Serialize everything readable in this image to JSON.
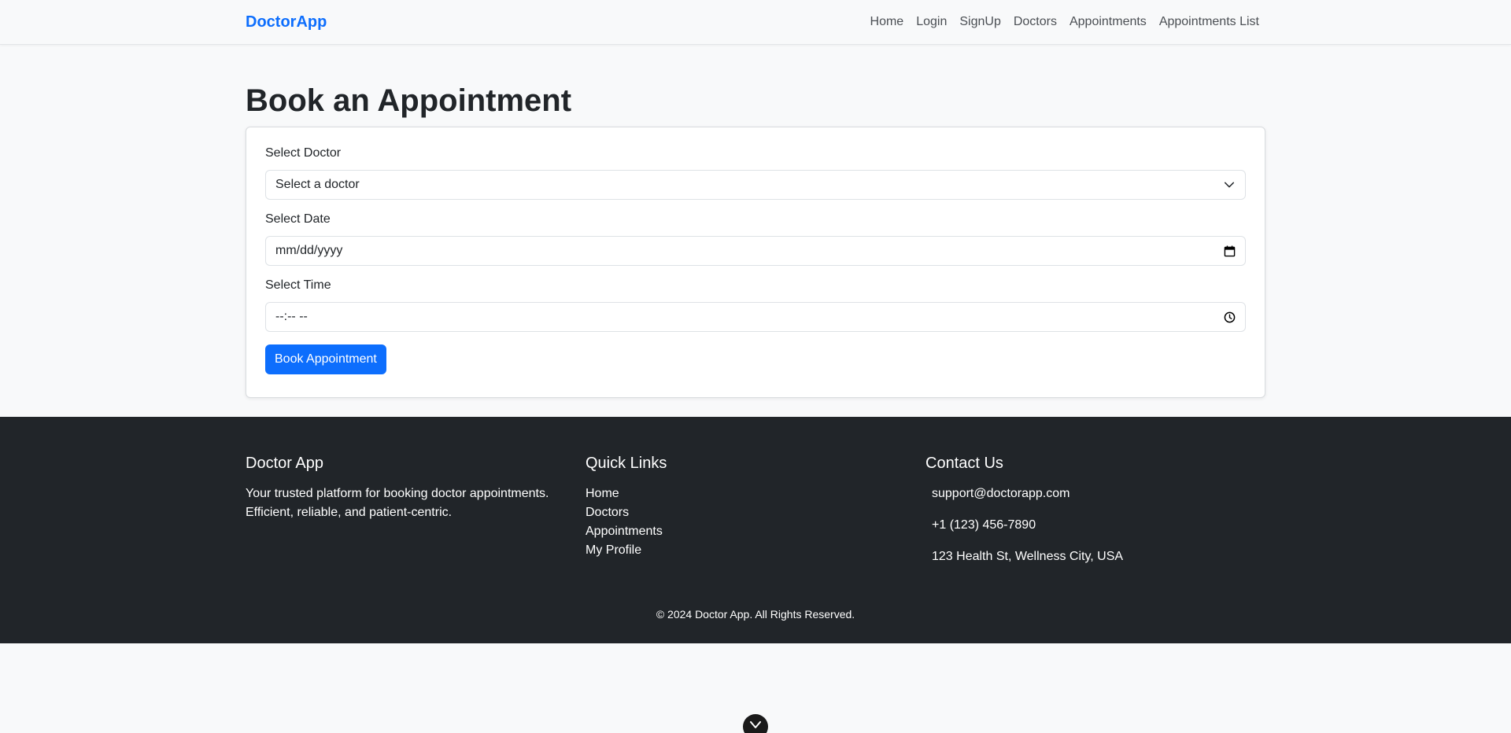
{
  "navbar": {
    "brand": "DoctorApp",
    "links": [
      "Home",
      "Login",
      "SignUp",
      "Doctors",
      "Appointments",
      "Appointments List"
    ]
  },
  "main": {
    "title": "Book an Appointment",
    "form": {
      "doctor_label": "Select Doctor",
      "doctor_value": "Select a doctor",
      "date_label": "Select Date",
      "date_value": "mm/dd/yyyy",
      "time_label": "Select Time",
      "time_value": "--:-- --",
      "submit_label": "Book Appointment"
    }
  },
  "footer": {
    "about": {
      "title": "Doctor App",
      "text": "Your trusted platform for booking doctor appointments. Efficient, reliable, and patient-centric."
    },
    "quick_links": {
      "title": "Quick Links",
      "links": [
        "Home",
        "Doctors",
        "Appointments",
        "My Profile"
      ]
    },
    "contact": {
      "title": "Contact Us",
      "email": "support@doctorapp.com",
      "phone": "+1 (123) 456-7890",
      "address": "123 Health St, Wellness City, USA"
    },
    "copyright": "© 2024 Doctor App. All Rights Reserved."
  },
  "colors": {
    "brand": "#0d6efd",
    "footer_bg": "#212529",
    "page_bg": "#f8f9fa"
  },
  "icons": [
    "chevron-down-icon",
    "calendar-icon",
    "clock-icon",
    "chevron-down-icon"
  ]
}
